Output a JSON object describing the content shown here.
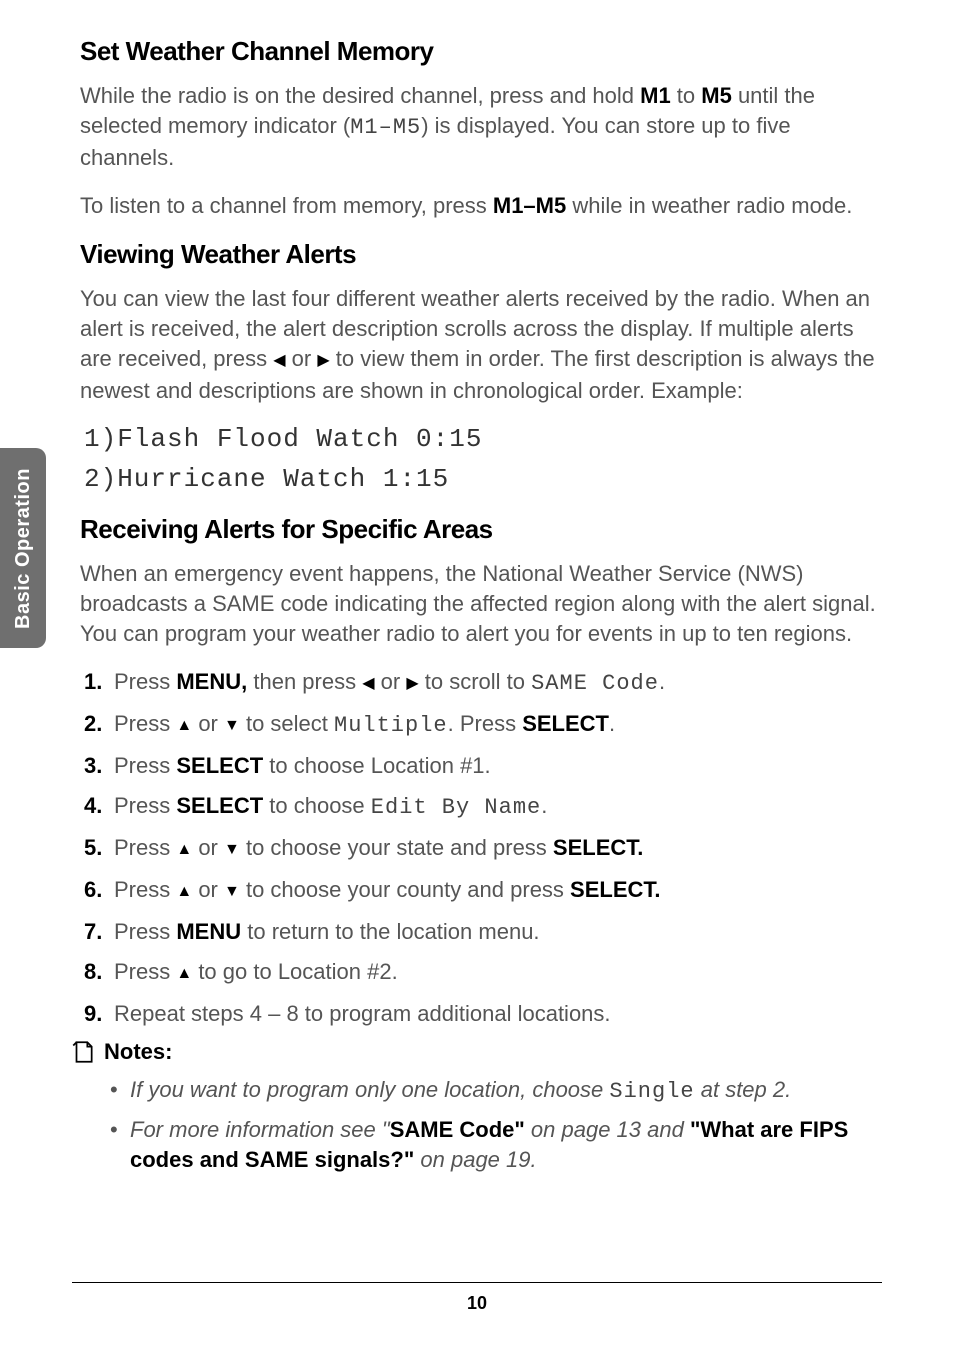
{
  "sidebar_label": "Basic Operation",
  "section1": {
    "heading": "Set Weather Channel Memory",
    "p1_a": "While the radio is on the desired channel, press and hold ",
    "p1_b": "M1",
    "p1_c": " to ",
    "p1_d": "M5",
    "p1_e": " until the selected memory indicator (",
    "p1_f": "M1–M5",
    "p1_g": ") is displayed. You can store up to five channels.",
    "p2_a": "To listen to a channel from memory, press ",
    "p2_b": "M1–M5",
    "p2_c": " while in weather radio mode."
  },
  "section2": {
    "heading": "Viewing Weather Alerts",
    "p1_a": "You can view the last four different weather alerts received by the radio. When an alert is received, the alert description scrolls across the display. If multiple alerts are received, press ",
    "p1_b": " or ",
    "p1_c": " to view them in order. The first description is always the newest and descriptions are shown in chronological order. Example:",
    "ex1": "1)Flash Flood Watch 0:15",
    "ex2": "2)Hurricane Watch 1:15"
  },
  "section3": {
    "heading": "Receiving Alerts for Specific Areas",
    "p1": "When an emergency event happens, the National Weather Service (NWS) broadcasts a SAME code indicating the affected region along with the alert signal. You can program your weather radio to alert you for events in up to ten regions.",
    "steps": {
      "s1_a": "Press ",
      "s1_b": "MENU,",
      "s1_c": " then press ",
      "s1_d": " or ",
      "s1_e": " to scroll to ",
      "s1_f": "SAME Code",
      "s1_g": ".",
      "s2_a": "Press ",
      "s2_b": " or ",
      "s2_c": " to select ",
      "s2_d": "Multiple",
      "s2_e": ". Press ",
      "s2_f": "SELECT",
      "s2_g": ".",
      "s3_a": "Press ",
      "s3_b": "SELECT",
      "s3_c": " to choose Location #1.",
      "s4_a": "Press ",
      "s4_b": "SELECT",
      "s4_c": " to choose ",
      "s4_d": "Edit By Name",
      "s4_e": ".",
      "s5_a": "Press ",
      "s5_b": " or ",
      "s5_c": " to choose your state and press ",
      "s5_d": "SELECT.",
      "s6_a": "Press ",
      "s6_b": " or ",
      "s6_c": " to choose your county and press ",
      "s6_d": "SELECT.",
      "s7_a": "Press ",
      "s7_b": "MENU",
      "s7_c": " to return to the location menu.",
      "s8_a": "Press ",
      "s8_b": " to go to Location #2.",
      "s9": "Repeat steps 4 – 8 to program additional locations."
    },
    "notes_label": "Notes:",
    "note1_a": "If you want to program only one location, choose ",
    "note1_b": "Single",
    "note1_c": " at step 2.",
    "note2_a": "For more information see \"",
    "note2_b": "SAME Code\"",
    "note2_c": " on page 13 and ",
    "note2_d": "\"What are FIPS codes and SAME signals?\"",
    "note2_e": " on page 19."
  },
  "page_number": "10",
  "arrows": {
    "left": "◀",
    "right": "▶",
    "up": "▲",
    "down": "▼"
  }
}
